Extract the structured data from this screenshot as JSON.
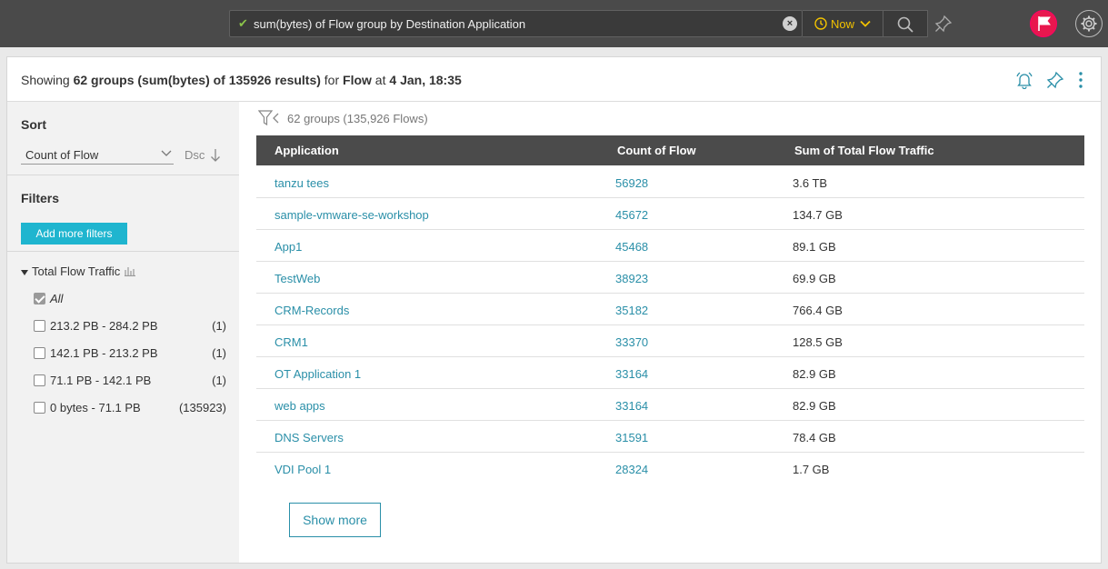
{
  "topbar": {
    "query": "sum(bytes) of Flow group by Destination Application",
    "time_label": "Now"
  },
  "header": {
    "showing_prefix": "Showing ",
    "groups_text": "62 groups (sum(bytes) of 135926 results)",
    "for_text": " for ",
    "entity": "Flow",
    "at_text": " at ",
    "timestamp": "4 Jan, 18:35"
  },
  "sidebar": {
    "sort_title": "Sort",
    "sort_value": "Count of Flow",
    "sort_order": "Dsc",
    "filters_title": "Filters",
    "add_filters_label": "Add more filters",
    "facet_title": "Total Flow Traffic",
    "facet_rows": [
      {
        "label": "All",
        "count": "",
        "checked": true
      },
      {
        "label": "213.2 PB - 284.2 PB",
        "count": "(1)",
        "checked": false
      },
      {
        "label": "142.1 PB - 213.2 PB",
        "count": "(1)",
        "checked": false
      },
      {
        "label": "71.1 PB - 142.1 PB",
        "count": "(1)",
        "checked": false
      },
      {
        "label": "0 bytes - 71.1 PB",
        "count": "(135923)",
        "checked": false
      }
    ]
  },
  "results": {
    "groups_summary": "62 groups (135,926 Flows)",
    "columns": [
      "Application",
      "Count of Flow",
      "Sum of Total Flow Traffic"
    ],
    "rows": [
      {
        "app": "tanzu tees",
        "count": "56928",
        "sum": "3.6 TB"
      },
      {
        "app": "sample-vmware-se-workshop",
        "count": "45672",
        "sum": "134.7 GB"
      },
      {
        "app": "App1",
        "count": "45468",
        "sum": "89.1 GB"
      },
      {
        "app": "TestWeb",
        "count": "38923",
        "sum": "69.9 GB"
      },
      {
        "app": "CRM-Records",
        "count": "35182",
        "sum": "766.4 GB"
      },
      {
        "app": "CRM1",
        "count": "33370",
        "sum": "128.5 GB"
      },
      {
        "app": "OT Application 1",
        "count": "33164",
        "sum": "82.9 GB"
      },
      {
        "app": "web apps",
        "count": "33164",
        "sum": "82.9 GB"
      },
      {
        "app": "DNS Servers",
        "count": "31591",
        "sum": "78.4 GB"
      },
      {
        "app": "VDI Pool 1",
        "count": "28324",
        "sum": "1.7 GB"
      }
    ],
    "show_more_label": "Show more"
  },
  "colors": {
    "accent": "#1fb5cf",
    "link": "#2a8fa8",
    "alert": "#e8174e",
    "time": "#f2c200"
  }
}
